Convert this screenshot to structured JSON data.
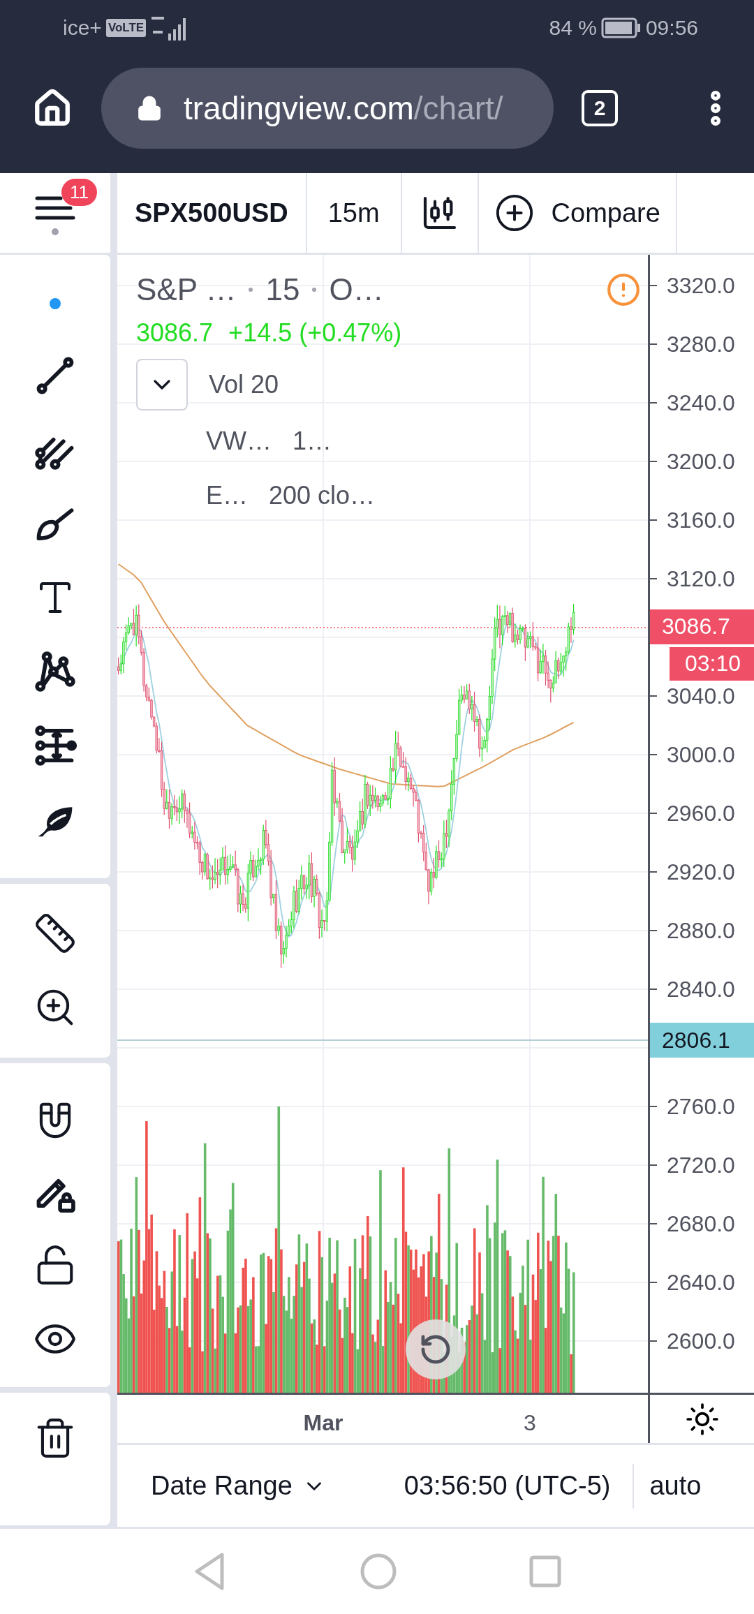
{
  "status_bar": {
    "carrier": "ice+",
    "volte": "VoLTE",
    "battery": "84 %",
    "time": "09:56"
  },
  "browser": {
    "url_host": "tradingview.com",
    "url_path": "/chart/",
    "tab_count": "2"
  },
  "toolbar": {
    "menu_badge": "11",
    "symbol": "SPX500USD",
    "interval": "15m",
    "compare": "Compare"
  },
  "legend": {
    "title": "S&P …",
    "interval": "15",
    "exchange": "O…",
    "price": "3086.7",
    "change": "+14.5 (+0.47%)",
    "expanded": false,
    "indicators": [
      {
        "name": "Vol 20"
      },
      {
        "name": "VW…",
        "value": "1…"
      },
      {
        "name": "E…",
        "value": "200 clo…"
      }
    ]
  },
  "price_scale": {
    "ticks": [
      "3320.0",
      "3280.0",
      "3240.0",
      "3200.0",
      "3160.0",
      "3120.0",
      "3040.0",
      "3000.0",
      "2960.0",
      "2920.0",
      "2880.0",
      "2840.0",
      "2760.0",
      "2720.0",
      "2680.0",
      "2640.0",
      "2600.0"
    ],
    "last_price": "3086.7",
    "countdown": "03:10",
    "crosshair_price": "2806.1"
  },
  "time_axis": {
    "labels": [
      {
        "text": "Mar",
        "bold": true
      },
      {
        "text": "3",
        "bold": false
      }
    ]
  },
  "bottom_bar": {
    "date_range": "Date Range",
    "time": "03:56:50 (UTC-5)",
    "scale": "auto"
  }
}
